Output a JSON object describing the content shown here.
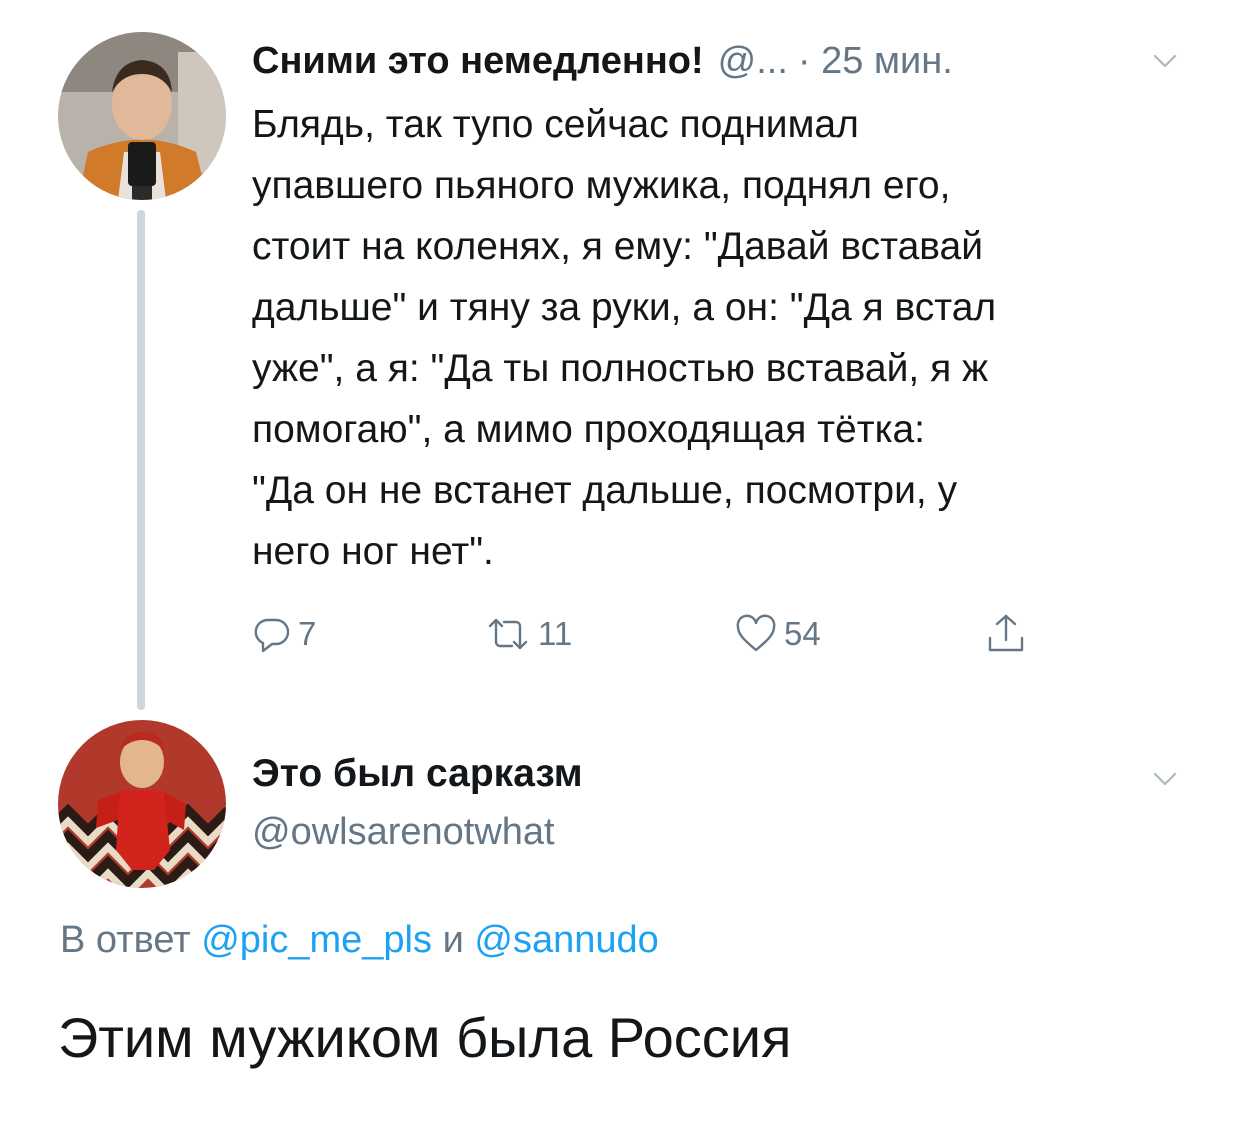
{
  "tweet1": {
    "display_name": "Сними это немедленно!",
    "handle": "@...",
    "time": "· 25 мин.",
    "body_lines": [
      "Блядь, так тупо сейчас поднимал",
      "упавшего пьяного мужика, поднял его,",
      "стоит на коленях, я ему: \"Давай вставай",
      "дальше\" и тяну за руки, а он: \"Да я встал",
      "уже\", а я: \"Да ты полностью вставай, я ж",
      "помогаю\", а мимо проходящая тётка:",
      "\"Да он не встанет дальше, посмотри, у",
      "него ног нет\"."
    ],
    "reply_count": "7",
    "retweet_count": "11",
    "like_count": "54"
  },
  "tweet2": {
    "display_name": "Это был сарказм",
    "handle": "@owlsarenotwhat",
    "reply_to": {
      "prefix": "В ответ",
      "mention1": "@pic_me_pls",
      "conjunction": "и",
      "mention2": "@sannudo"
    },
    "body": "Этим мужиком была Россия"
  },
  "colors": {
    "text": "#14171a",
    "secondary": "#657786",
    "link": "#1da1f2",
    "thread_line": "#ccd6dd"
  },
  "icons": [
    "chevron-down-icon",
    "reply-icon",
    "retweet-icon",
    "like-icon",
    "share-icon"
  ]
}
